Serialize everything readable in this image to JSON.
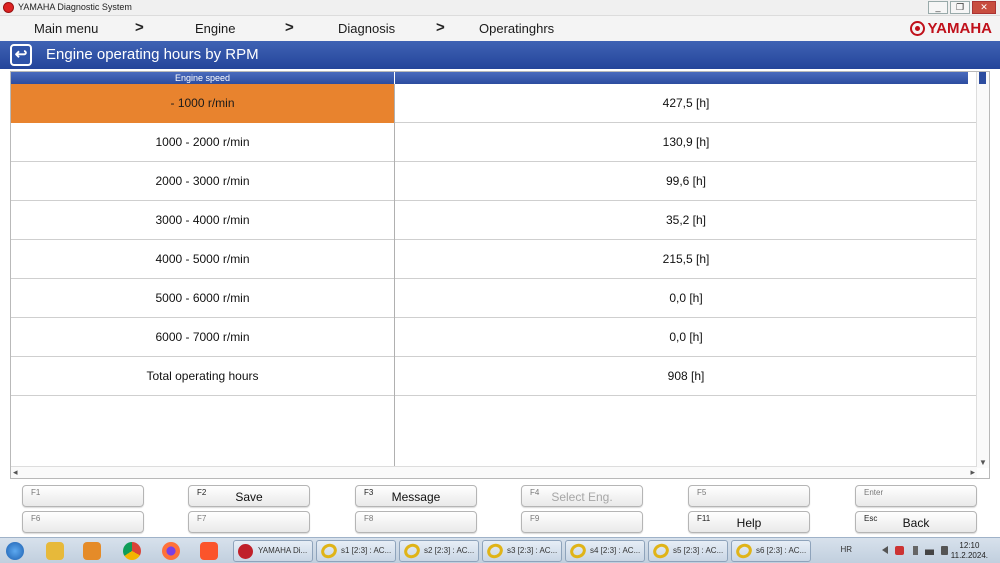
{
  "window": {
    "title": "YAMAHA Diagnostic System",
    "buttons": [
      "_",
      "❐",
      "✕"
    ]
  },
  "nav": {
    "crumbs": [
      "Main menu",
      "Engine",
      "Diagnosis",
      "Operatinghrs"
    ],
    "separator": ">",
    "brand": "YAMAHA"
  },
  "header": {
    "title": "Engine operating hours by RPM"
  },
  "table": {
    "column_header": "Engine speed",
    "rows": [
      {
        "rpm": " -  1000 r/min",
        "hours": "427,5 [h]"
      },
      {
        "rpm": "1000  -  2000 r/min",
        "hours": "130,9 [h]"
      },
      {
        "rpm": "2000  -  3000 r/min",
        "hours": "99,6 [h]"
      },
      {
        "rpm": "3000  -  4000 r/min",
        "hours": "35,2 [h]"
      },
      {
        "rpm": "4000  -  5000 r/min",
        "hours": "215,5 [h]"
      },
      {
        "rpm": "5000  -  6000 r/min",
        "hours": "0,0 [h]"
      },
      {
        "rpm": "6000  -  7000 r/min",
        "hours": "0,0 [h]"
      },
      {
        "rpm": "Total operating hours",
        "hours": "908 [h]"
      }
    ],
    "selected_row": 0,
    "selected_color": "#e8832e"
  },
  "function_keys": [
    {
      "key": "F1",
      "label": ""
    },
    {
      "key": "F2",
      "label": "Save"
    },
    {
      "key": "F3",
      "label": "Message"
    },
    {
      "key": "F4",
      "label": "Select Eng."
    },
    {
      "key": "F5",
      "label": ""
    },
    {
      "key": "Enter",
      "label": ""
    },
    {
      "key": "F6",
      "label": ""
    },
    {
      "key": "F7",
      "label": ""
    },
    {
      "key": "F8",
      "label": ""
    },
    {
      "key": "F9",
      "label": ""
    },
    {
      "key": "F11",
      "label": "Help"
    },
    {
      "key": "Esc",
      "label": "Back"
    }
  ],
  "taskbar": {
    "tasks": [
      "YAMAHA Di...",
      "s1 [2:3] : AC...",
      "s2 [2:3] : AC...",
      "s3 [2:3] : AC...",
      "s4 [2:3] : AC...",
      "s5 [2:3] : AC...",
      "s6 [2:3] : AC..."
    ],
    "language": "HR",
    "time": "12:10",
    "date": "11.2.2024."
  },
  "colors": {
    "header_blue": "#2c4c9f",
    "brand_red": "#c0101a"
  }
}
